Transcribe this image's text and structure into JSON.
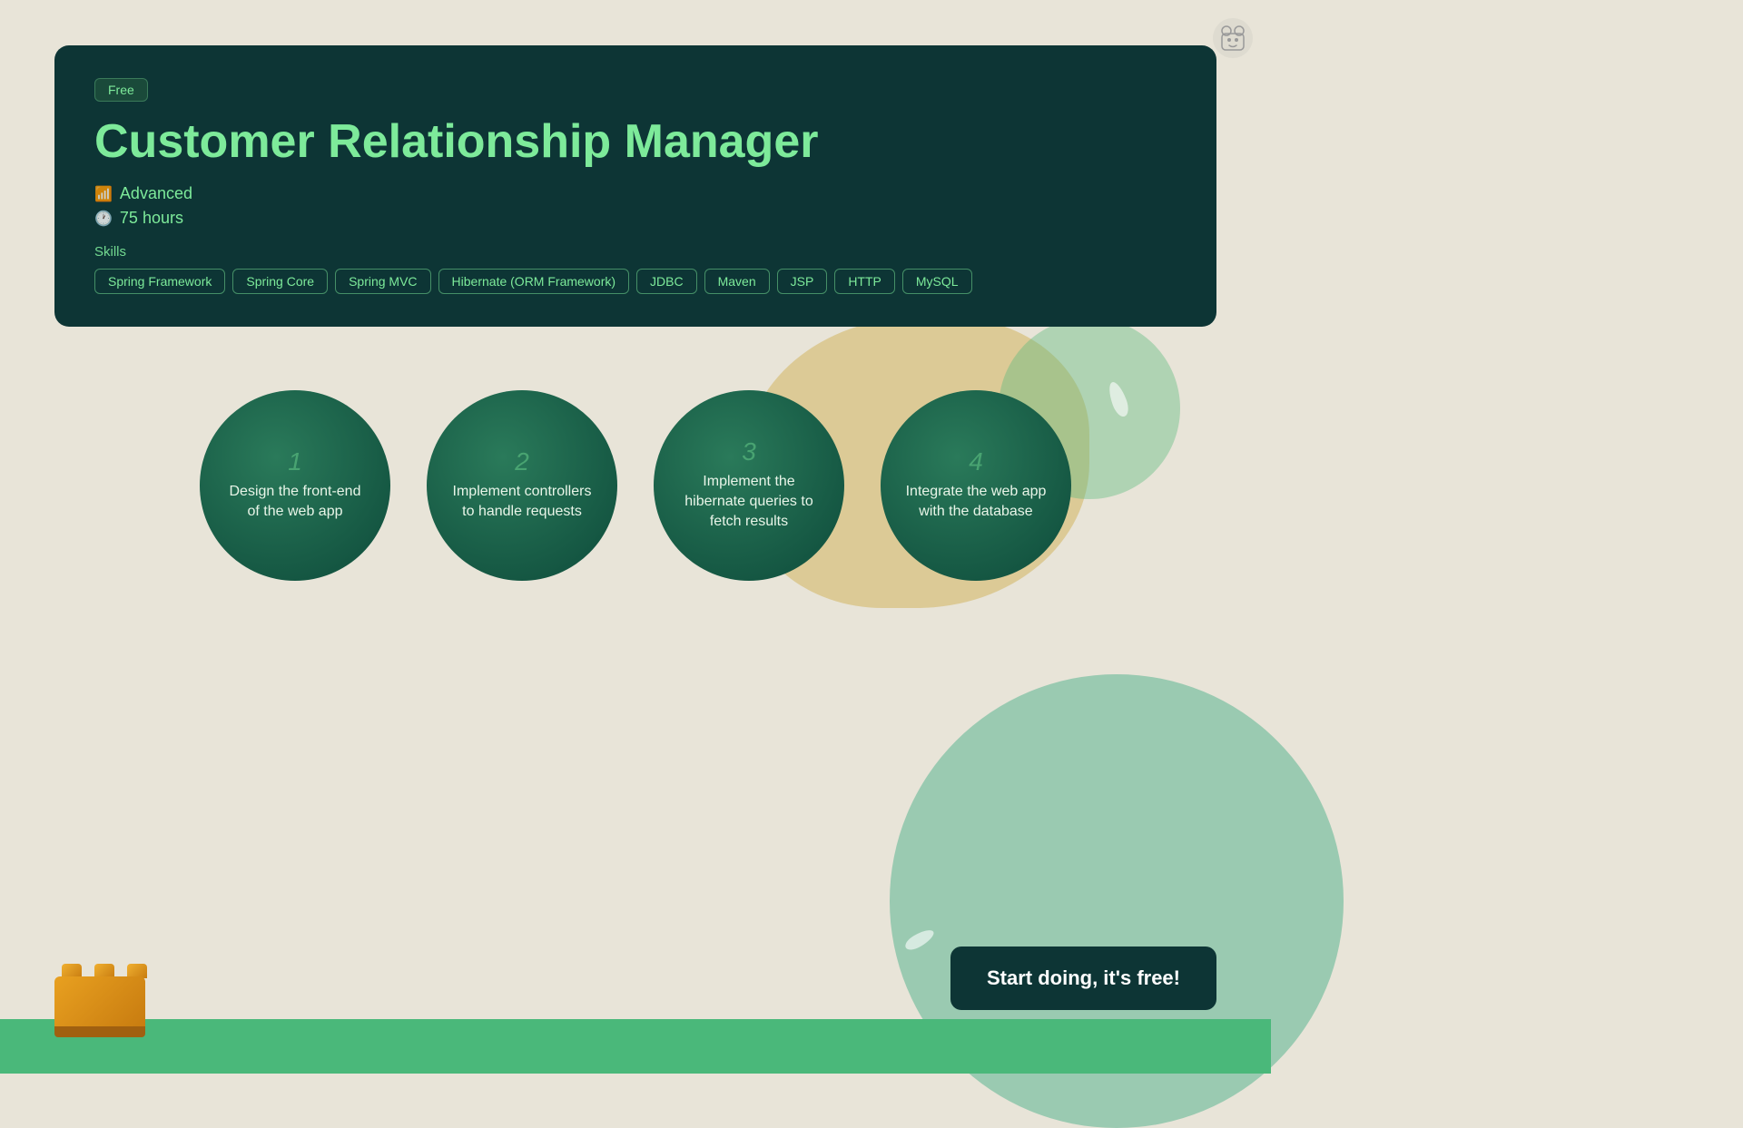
{
  "badge": {
    "label": "Free"
  },
  "course": {
    "title": "Customer Relationship Manager",
    "level": "Advanced",
    "duration": "75 hours",
    "skills_label": "Skills"
  },
  "skills": [
    "Spring Framework",
    "Spring Core",
    "Spring MVC",
    "Hibernate (ORM Framework)",
    "JDBC",
    "Maven",
    "JSP",
    "HTTP",
    "MySQL"
  ],
  "steps": [
    {
      "number": "1",
      "text": "Design the front-end of the web app"
    },
    {
      "number": "2",
      "text": "Implement controllers to handle requests"
    },
    {
      "number": "3",
      "text": "Implement the hibernate queries to fetch results"
    },
    {
      "number": "4",
      "text": "Integrate the web app with the database"
    }
  ],
  "cta": {
    "label": "Start doing, it's free!"
  }
}
